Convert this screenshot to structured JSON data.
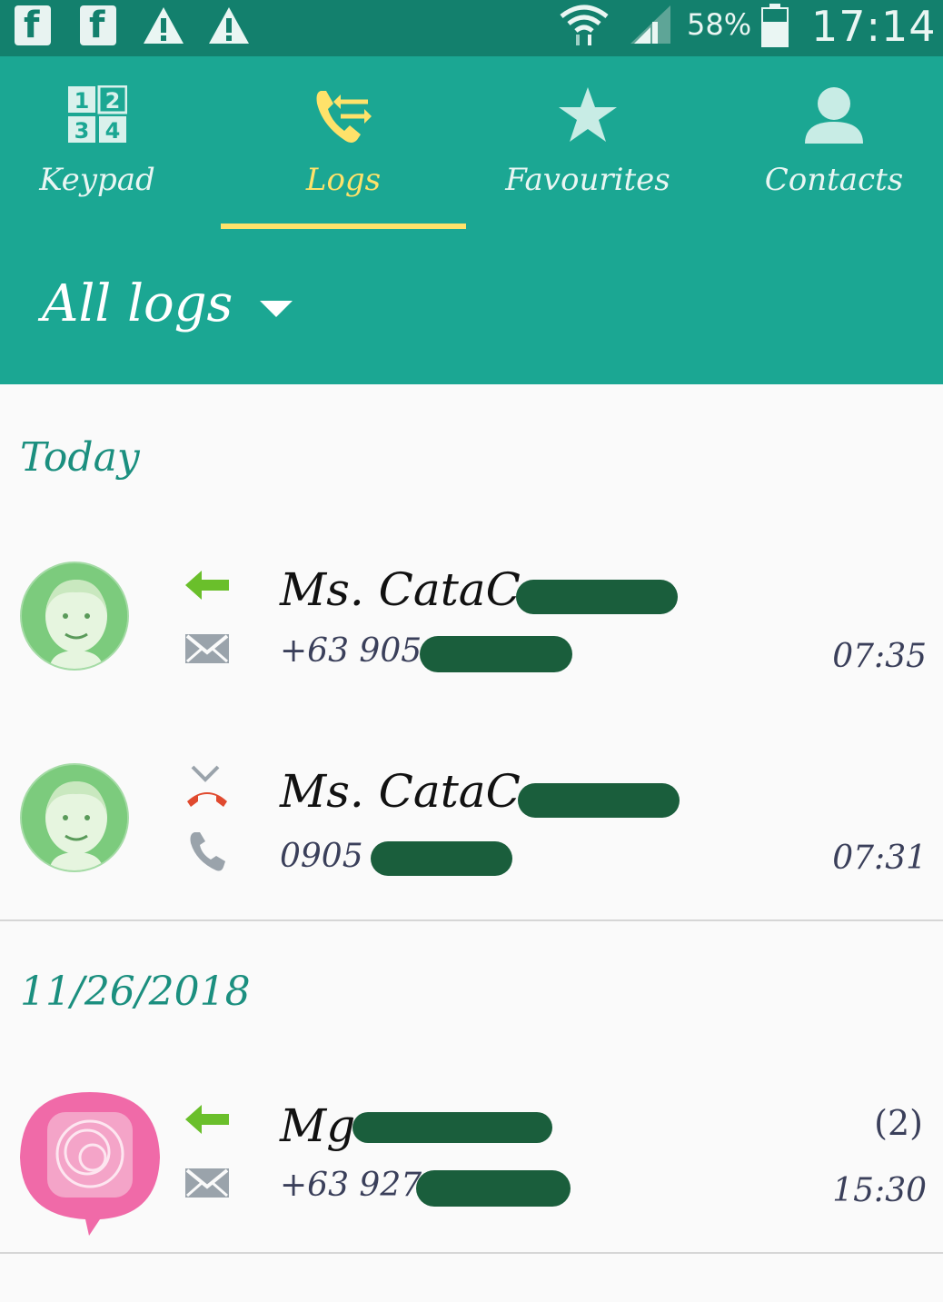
{
  "status_bar": {
    "battery": "58%",
    "time": "17:14",
    "icons": [
      "facebook-icon",
      "facebook-icon",
      "warning-icon",
      "warning-icon",
      "wifi-icon",
      "signal-icon",
      "battery-icon"
    ]
  },
  "tabs": [
    {
      "label": "Keypad",
      "icon": "keypad-icon"
    },
    {
      "label": "Logs",
      "icon": "call-logs-icon",
      "active": true
    },
    {
      "label": "Favourites",
      "icon": "star-icon"
    },
    {
      "label": "Contacts",
      "icon": "person-icon"
    }
  ],
  "filter": {
    "label": "All logs"
  },
  "sections": [
    {
      "header": "Today",
      "entries": [
        {
          "name": "Ms. CataC",
          "number": "+63 905",
          "time": "07:35",
          "direction": "outgoing",
          "secondary_icon": "message-icon"
        },
        {
          "name": "Ms. CataC",
          "number": "0905",
          "time": "07:31",
          "direction": "missed",
          "secondary_icon": "phone-icon"
        }
      ]
    },
    {
      "header": "11/26/2018",
      "entries": [
        {
          "name": "Mg",
          "number": "+63 927",
          "time": "15:30",
          "count": "(2)",
          "direction": "outgoing",
          "secondary_icon": "message-icon"
        }
      ]
    }
  ],
  "colors": {
    "status_bar": "#13806d",
    "header": "#1ba793",
    "accent": "#ffe26a",
    "section_text": "#1b8f7f",
    "redaction": "#1a5e3c",
    "outgoing_arrow": "#6abf2b",
    "missed_red": "#e04a2f"
  }
}
